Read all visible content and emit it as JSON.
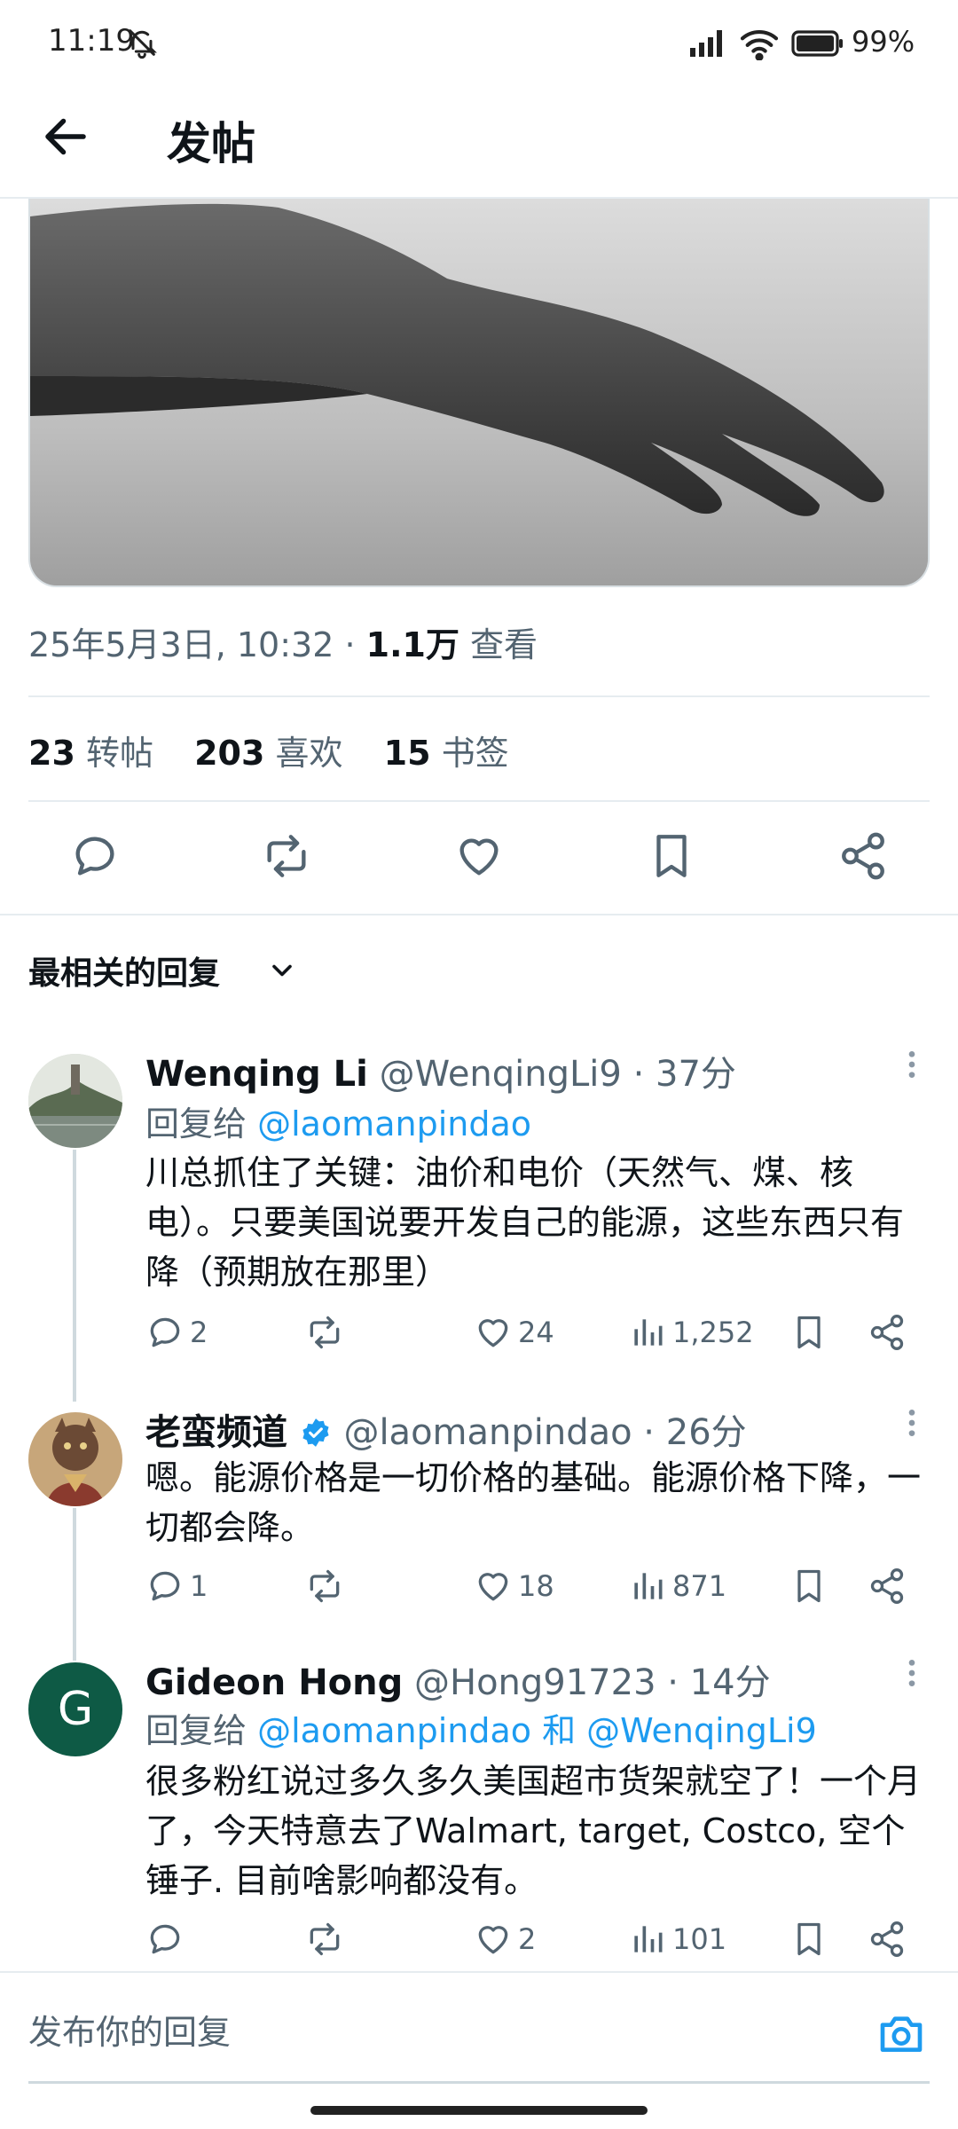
{
  "status_bar": {
    "time": "11:19",
    "battery": "99%"
  },
  "header": {
    "title": "发帖"
  },
  "post": {
    "timestamp": "25年5月3日, 10:32 · ",
    "views_count": "1.1万",
    "views_label": " 查看",
    "stats": {
      "reposts_count": "23",
      "reposts_label": "转帖",
      "likes_count": "203",
      "likes_label": "喜欢",
      "bookmarks_count": "15",
      "bookmarks_label": "书签"
    }
  },
  "sort": {
    "label": "最相关的回复"
  },
  "replies": [
    {
      "name": "Wenqing Li",
      "handle": "@WenqingLi9 · 37分",
      "reply_to_prefix": "回复给 ",
      "reply_to": "@laomanpindao",
      "text": "川总抓住了关键：油价和电价（天然气、煤、核电）。只要美国说要开发自己的能源，这些东西只有降（预期放在那里）",
      "comments": "2",
      "reposts": "",
      "likes": "24",
      "views": "1,252"
    },
    {
      "name": "老蛮频道",
      "verified": true,
      "handle": "@laomanpindao · 26分",
      "text": "嗯。能源价格是一切价格的基础。能源价格下降，一切都会降。",
      "comments": "1",
      "reposts": "",
      "likes": "18",
      "views": "871"
    },
    {
      "name": "Gideon Hong",
      "avatar_letter": "G",
      "handle": "@Hong91723 · 14分",
      "reply_to_prefix": "回复给 ",
      "reply_to": "@laomanpindao 和 @WenqingLi9",
      "text": "很多粉红说过多久多久美国超市货架就空了！一个月了，今天特意去了Walmart, target, Costco, 空个锤子. 目前啥影响都没有。",
      "comments": "",
      "reposts": "",
      "likes": "2",
      "views": "101"
    }
  ],
  "composer": {
    "placeholder": "发布你的回复"
  },
  "colors": {
    "accent": "#1d9bf0",
    "text": "#0f1419",
    "secondary": "#536471",
    "avatar_green": "#0e5a45"
  }
}
